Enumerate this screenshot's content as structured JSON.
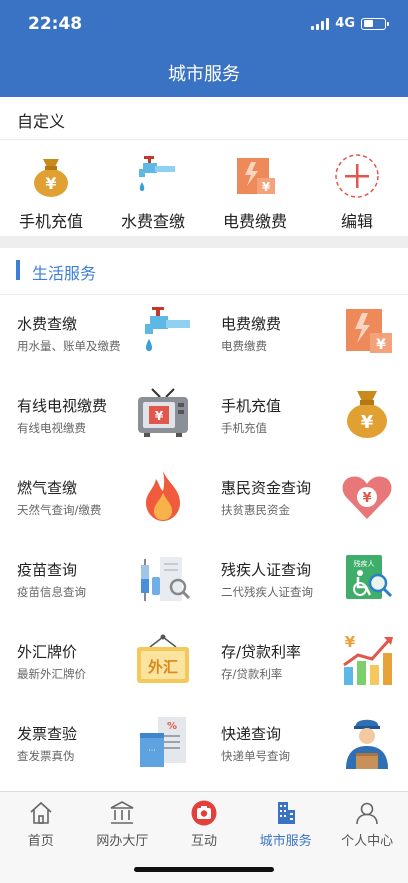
{
  "status": {
    "time": "22:48",
    "network": "4G",
    "battery_level": 0.45
  },
  "header": {
    "title": "城市服务"
  },
  "custom": {
    "label": "自定义",
    "shortcuts": [
      {
        "label": "手机充值",
        "icon": "money-bag-icon"
      },
      {
        "label": "水费查缴",
        "icon": "water-faucet-icon"
      },
      {
        "label": "电费缴费",
        "icon": "electric-bill-icon"
      },
      {
        "label": "编辑",
        "icon": "add-edit-icon"
      }
    ]
  },
  "section": {
    "title": "生活服务"
  },
  "services": [
    {
      "name": "水费查缴",
      "desc": "用水量、账单及缴费",
      "icon": "water-faucet-icon"
    },
    {
      "name": "电费缴费",
      "desc": "电费缴费",
      "icon": "electric-bill-icon"
    },
    {
      "name": "有线电视缴费",
      "desc": "有线电视缴费",
      "icon": "tv-icon"
    },
    {
      "name": "手机充值",
      "desc": "手机充值",
      "icon": "money-bag-icon"
    },
    {
      "name": "燃气查缴",
      "desc": "天然气查询/缴费",
      "icon": "flame-icon"
    },
    {
      "name": "惠民资金查询",
      "desc": "扶贫惠民资金",
      "icon": "heart-fund-icon"
    },
    {
      "name": "疫苗查询",
      "desc": "疫苗信息查询",
      "icon": "vaccine-icon"
    },
    {
      "name": "残疾人证查询",
      "desc": "二代残疾人证查询",
      "icon": "disability-card-icon",
      "icon_text": "残疾人"
    },
    {
      "name": "外汇牌价",
      "desc": "最新外汇牌价",
      "icon": "forex-sign-icon",
      "icon_text": "外汇"
    },
    {
      "name": "存/贷款利率",
      "desc": "存/贷款利率",
      "icon": "rate-chart-icon"
    },
    {
      "name": "发票查验",
      "desc": "查发票真伪",
      "icon": "invoice-icon"
    },
    {
      "name": "快递查询",
      "desc": "快递单号查询",
      "icon": "courier-icon"
    }
  ],
  "tabs": [
    {
      "label": "首页",
      "icon": "home-icon",
      "active": false
    },
    {
      "label": "网办大厅",
      "icon": "hall-icon",
      "active": false
    },
    {
      "label": "互动",
      "icon": "camera-icon",
      "active": false
    },
    {
      "label": "城市服务",
      "icon": "city-building-icon",
      "active": true
    },
    {
      "label": "个人中心",
      "icon": "person-icon",
      "active": false
    }
  ],
  "colors": {
    "header": "#3b73c4",
    "accent": "#3b7fd6",
    "band": "#eeeeee"
  }
}
